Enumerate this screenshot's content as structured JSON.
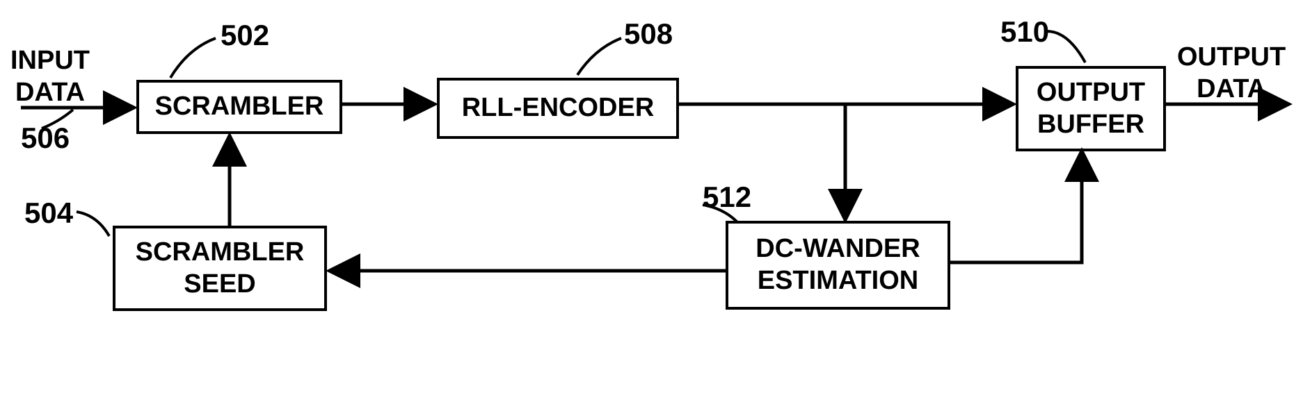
{
  "labels": {
    "input_data": "INPUT\nDATA",
    "output_data": "OUTPUT\nDATA"
  },
  "boxes": {
    "scrambler": "SCRAMBLER",
    "rll_encoder": "RLL-ENCODER",
    "output_buffer": "OUTPUT\nBUFFER",
    "scrambler_seed": "SCRAMBLER\nSEED",
    "dc_wander": "DC-WANDER\nESTIMATION"
  },
  "refs": {
    "r502": "502",
    "r504": "504",
    "r506": "506",
    "r508": "508",
    "r510": "510",
    "r512": "512"
  }
}
